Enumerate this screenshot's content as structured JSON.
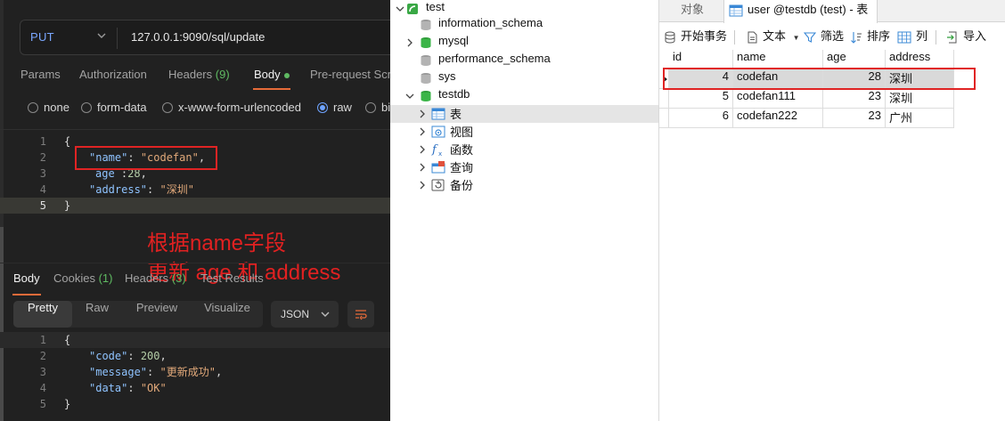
{
  "request": {
    "method": "PUT",
    "url": "127.0.0.1:9090/sql/update"
  },
  "request_tabs": [
    {
      "label": "Params"
    },
    {
      "label": "Authorization"
    },
    {
      "label": "Headers",
      "count": "(9)"
    },
    {
      "label": "Body"
    },
    {
      "label": "Pre-request Scr"
    }
  ],
  "body_modes": [
    "none",
    "form-data",
    "x-www-form-urlencoded",
    "raw",
    "bi"
  ],
  "request_body_lines": [
    {
      "n": "1",
      "text": "{"
    },
    {
      "n": "2",
      "key": "\"name\"",
      "sep": ": ",
      "val": "\"codefan\"",
      "end": ","
    },
    {
      "n": "3",
      "key": "age",
      "sep": " :",
      "val": "28",
      "end": ","
    },
    {
      "n": "4",
      "key": "\"address\"",
      "sep": ": ",
      "val": "\"深圳\"",
      "end": ""
    },
    {
      "n": "5",
      "text": "}"
    }
  ],
  "annotation": {
    "line1": "根据name字段",
    "line2": "更新 age 和 address"
  },
  "response_tabs": [
    {
      "label": "Body"
    },
    {
      "label": "Cookies",
      "count": "(1)"
    },
    {
      "label": "Headers",
      "count": "(3)"
    },
    {
      "label": "Test Results"
    }
  ],
  "view_modes": [
    "Pretty",
    "Raw",
    "Preview",
    "Visualize"
  ],
  "response_format": "JSON",
  "response_body_lines": [
    {
      "n": "1",
      "text": "{"
    },
    {
      "n": "2",
      "key": "\"code\"",
      "sep": ": ",
      "val": "200",
      "end": ","
    },
    {
      "n": "3",
      "key": "\"message\"",
      "sep": ": ",
      "val": "\"更新成功\"",
      "end": ","
    },
    {
      "n": "4",
      "key": "\"data\"",
      "sep": ": ",
      "val": "\"OK\"",
      "end": ""
    },
    {
      "n": "5",
      "text": "}"
    }
  ],
  "tree": {
    "connection": "test",
    "databases": [
      "information_schema",
      "mysql",
      "performance_schema",
      "sys",
      "testdb"
    ],
    "testdb_children": [
      "表",
      "视图",
      "函数",
      "查询",
      "备份"
    ]
  },
  "grid": {
    "tabs": [
      "对象",
      "user @testdb (test) - 表"
    ],
    "toolbar": [
      "开始事务",
      "文本",
      "筛选",
      "排序",
      "列",
      "导入"
    ],
    "columns": [
      "id",
      "name",
      "age",
      "address"
    ],
    "rows": [
      [
        "4",
        "codefan",
        "28",
        "深圳"
      ],
      [
        "5",
        "codefan111",
        "23",
        "深圳"
      ],
      [
        "6",
        "codefan222",
        "23",
        "广州"
      ]
    ]
  },
  "colors": {
    "accent_green": "#5fba62",
    "method_blue": "#7aa7ff",
    "highlight_red": "#e02424",
    "tab_orange": "#e76b39"
  }
}
